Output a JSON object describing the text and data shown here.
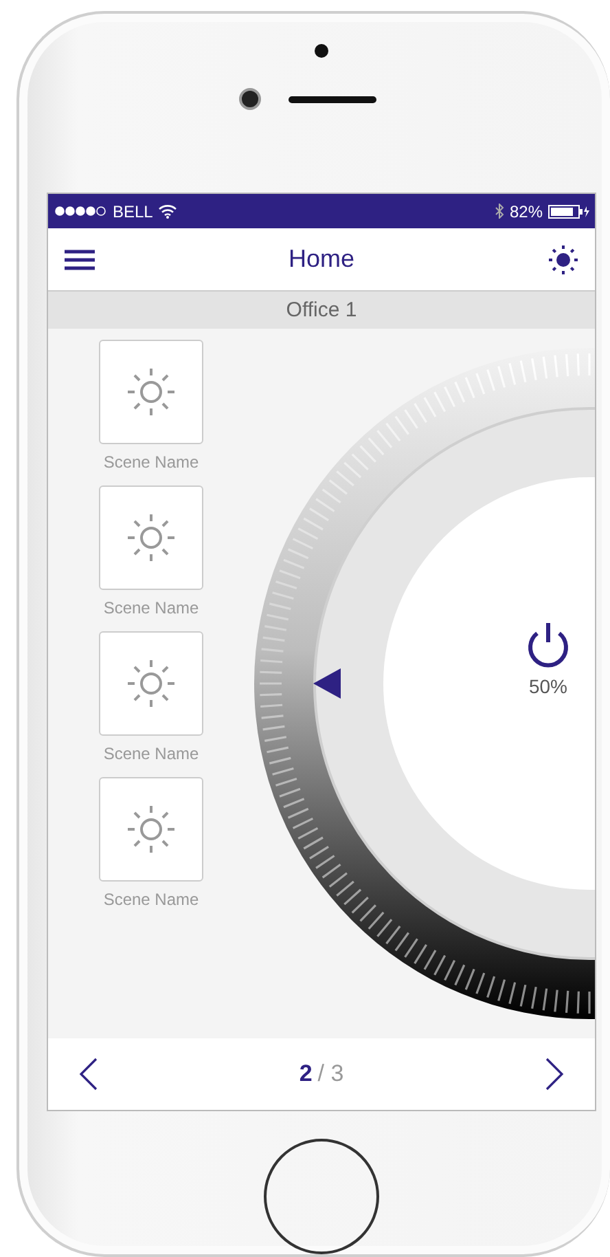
{
  "status_bar": {
    "carrier": "BELL",
    "battery": "82%"
  },
  "nav_bar": {
    "title": "Home"
  },
  "room": {
    "name": "Office 1"
  },
  "scenes": [
    {
      "label": "Scene Name"
    },
    {
      "label": "Scene Name"
    },
    {
      "label": "Scene Name"
    },
    {
      "label": "Scene Name"
    }
  ],
  "dial": {
    "reading": "50%"
  },
  "pager": {
    "current": "2",
    "total": "/ 3"
  }
}
